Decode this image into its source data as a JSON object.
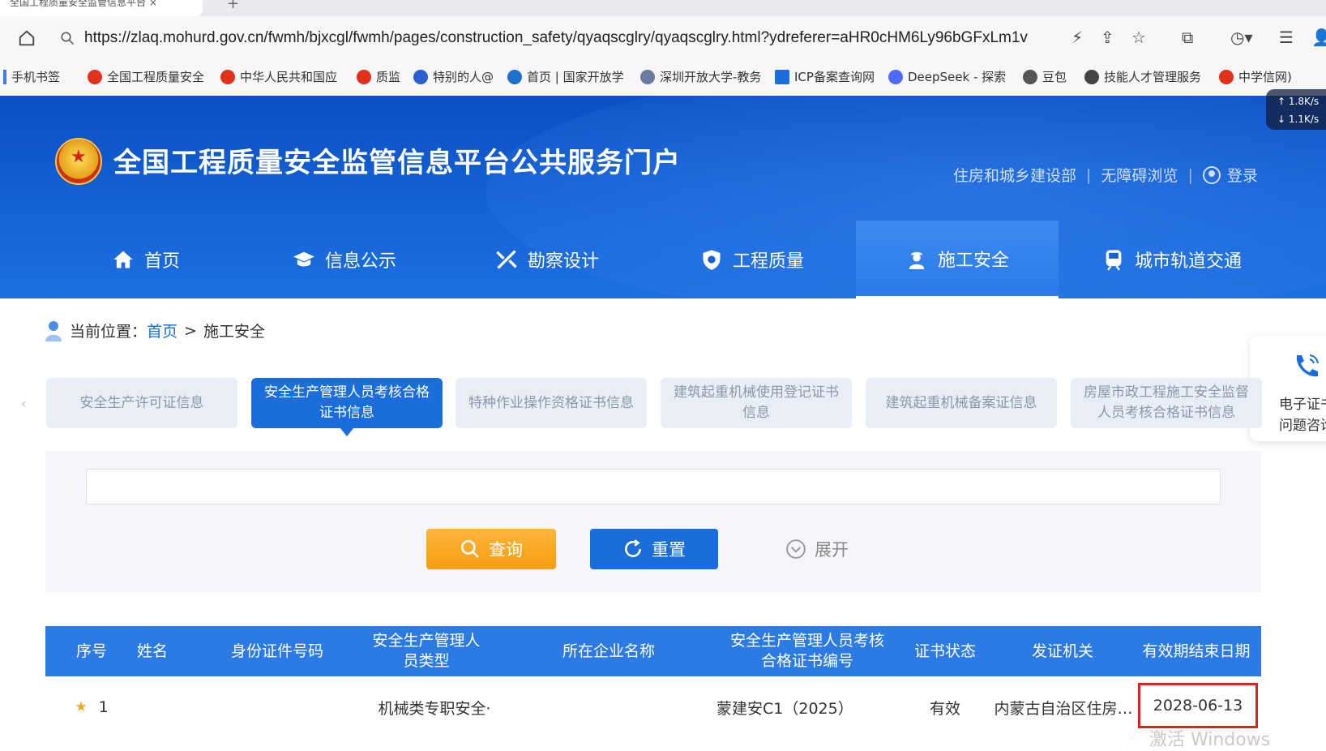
{
  "browser": {
    "tab_title": "全国工程质量安全监管信息平台 ×",
    "url": "https://zlaq.mohurd.gov.cn/fwmh/bjxcgl/fwmh/pages/construction_safety/qyaqscglry/qyaqscglry.html?ydreferer=aHR0cHM6Ly96bGFxLm1v",
    "bookmarks": [
      "手机书签",
      "全国工程质量安全",
      "中华人民共和国应",
      "质监",
      "特别的人@",
      "首页 | 国家开放学",
      "深圳开放大学-教务",
      "ICP备案查询网",
      "DeepSeek - 探索",
      "豆包",
      "技能人才管理服务",
      "中学信网)"
    ],
    "speed_up": "↑ 1.8K/s",
    "speed_down": "↓ 1.1K/s"
  },
  "header": {
    "site_title": "全国工程质量安全监管信息平台公共服务门户",
    "link_ministry": "住房和城乡建设部",
    "link_accessible": "无障碍浏览",
    "link_login": "登录"
  },
  "nav": {
    "items": [
      {
        "label": "首页"
      },
      {
        "label": "信息公示"
      },
      {
        "label": "勘察设计"
      },
      {
        "label": "工程质量"
      },
      {
        "label": "施工安全"
      },
      {
        "label": "城市轨道交通"
      }
    ]
  },
  "breadcrumb": {
    "prefix": "当前位置：",
    "home": "首页",
    "sep": ">",
    "current": "施工安全"
  },
  "side_float": {
    "line1": "电子证书",
    "line2": "问题咨询"
  },
  "subtabs": {
    "items": [
      {
        "label": "安全生产许可证信息"
      },
      {
        "label": "安全生产管理人员考核合格证书信息"
      },
      {
        "label": "特种作业操作资格证书信息"
      },
      {
        "label": "建筑起重机械使用登记证书信息"
      },
      {
        "label": "建筑起重机械备案证信息"
      },
      {
        "label": "房屋市政工程施工安全监督人员考核合格证书信息"
      }
    ]
  },
  "search": {
    "input_value": "",
    "query_label": "查询",
    "reset_label": "重置",
    "expand_label": "展开"
  },
  "table": {
    "headers": [
      "序号",
      "姓名",
      "身份证件号码",
      "安全生产管理人员类型",
      "所在企业名称",
      "安全生产管理人员考核合格证书编号",
      "证书状态",
      "发证机关",
      "有效期结束日期"
    ],
    "rows": [
      {
        "index": "1",
        "name": "",
        "id_number": "",
        "type": "机械类专职安全·",
        "company": "",
        "cert_no": "蒙建安C1（2025）",
        "status": "有效",
        "issuer": "内蒙古自治区住房…",
        "end_date": "2028-06-13"
      }
    ]
  },
  "watermark": "激活 Windows",
  "colors": {
    "primary": "#1a6ddb",
    "header_bg": "#0b4fc3",
    "query_btn": "#f59d14",
    "highlight": "#d9261c"
  }
}
